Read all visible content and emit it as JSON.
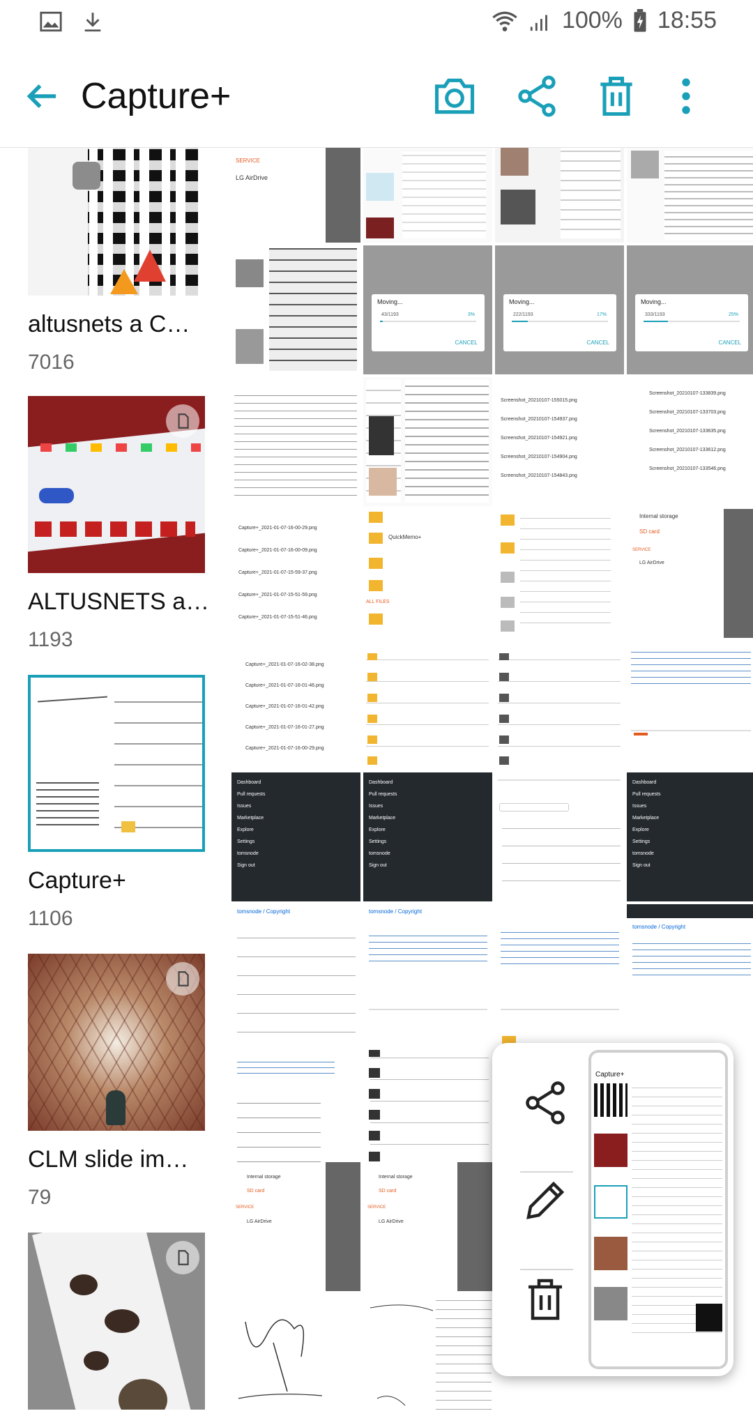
{
  "status_bar": {
    "battery": "100%",
    "time": "18:55",
    "icons": [
      "gallery-notification-icon",
      "download-icon",
      "wifi-icon",
      "signal-icon",
      "battery-charging-icon"
    ]
  },
  "app_bar": {
    "title": "Capture+",
    "actions": [
      "camera-icon",
      "share-icon",
      "trash-icon",
      "more-vert-icon"
    ]
  },
  "albums": [
    {
      "name": "altusnets a C…",
      "count": "7016",
      "selected": false,
      "sd": false
    },
    {
      "name": "ALTUSNETS a…",
      "count": "1193",
      "selected": false,
      "sd": true
    },
    {
      "name": "Capture+",
      "count": "1106",
      "selected": true,
      "sd": false
    },
    {
      "name": "CLM slide im…",
      "count": "79",
      "selected": false,
      "sd": true
    },
    {
      "name": "",
      "count": "",
      "selected": false,
      "sd": true
    }
  ],
  "grid": {
    "moving_dialogs": [
      {
        "title": "Moving...",
        "progress_text": "43/1193",
        "percent": "3%",
        "cancel": "CANCEL"
      },
      {
        "title": "Moving...",
        "progress_text": "222/1193",
        "percent": "17%",
        "cancel": "CANCEL"
      },
      {
        "title": "Moving...",
        "progress_text": "333/1193",
        "percent": "25%",
        "cancel": "CANCEL"
      }
    ],
    "screenshot_files": [
      "Screenshot_20210107-155015.png",
      "Screenshot_20210107-154937.png",
      "Screenshot_20210107-154921.png",
      "Screenshot_20210107-154904.png",
      "Screenshot_20210107-154843.png"
    ],
    "screenshot_files_2": [
      "Screenshot_20210107-133839.png",
      "Screenshot_20210107-133703.png",
      "Screenshot_20210107-133635.png",
      "Screenshot_20210107-133612.png",
      "Screenshot_20210107-133546.png"
    ],
    "capture_files": [
      "Capture+_2021-01-07-16-00-29.png",
      "Capture+_2021-01-07-16-00-09.png",
      "Capture+_2021-01-07-15-59-37.png",
      "Capture+_2021-01-07-15-51-59.png",
      "Capture+_2021-01-07-15-51-46.png"
    ],
    "capture_files_2": [
      "Capture+_2021-01-07-16-02-38.png",
      "Capture+_2021-01-07-16-01-46.png",
      "Capture+_2021-01-07-16-01-42.png",
      "Capture+_2021-01-07-16-01-27.png",
      "Capture+_2021-01-07-16-00-29.png"
    ],
    "repo_title": "tomsnode / Copyright",
    "dark_menu": [
      "Dashboard",
      "Pull requests",
      "Issues",
      "Marketplace",
      "Explore",
      "Settings",
      "tomsnode",
      "Sign out"
    ],
    "storage_internal": "Internal storage",
    "storage_sd": "SD card",
    "service_label": "SERVICE",
    "lg_airdrive": "LG AirDrive",
    "folder_quickmemo": "QuickMemo+",
    "all_files": "ALL FILES"
  },
  "popup": {
    "actions": [
      "share-icon",
      "edit-icon",
      "trash-icon"
    ],
    "preview_title": "Capture+"
  },
  "colors": {
    "accent": "#1a9fb8",
    "title": "#111111",
    "muted": "#666666"
  }
}
